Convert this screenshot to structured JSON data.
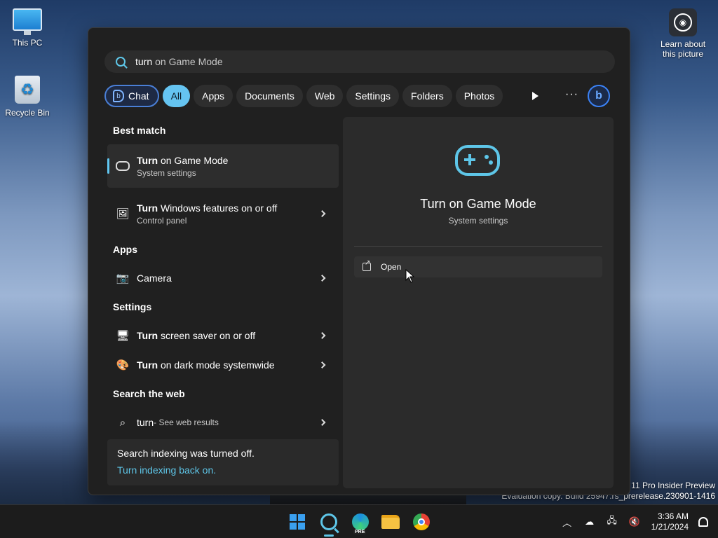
{
  "desktop": {
    "icons": [
      {
        "label": "This PC"
      },
      {
        "label": "Recycle Bin"
      }
    ],
    "learn_label_1": "Learn about",
    "learn_label_2": "this picture",
    "watermark_line1": "11 Pro Insider Preview",
    "watermark_line2": "Evaluation copy. Build 25947.rs_prerelease.230901-1416"
  },
  "search": {
    "typed": "turn",
    "completion": "on Game Mode"
  },
  "filters": {
    "chat": "Chat",
    "items": [
      "All",
      "Apps",
      "Documents",
      "Web",
      "Settings",
      "Folders",
      "Photos"
    ],
    "active": "All",
    "more": "···"
  },
  "results": {
    "best_match_header": "Best match",
    "best": {
      "bold": "Turn",
      "rest": " on Game Mode",
      "sub": "System settings"
    },
    "second": {
      "bold": "Turn",
      "rest": " Windows features on or off",
      "sub": "Control panel"
    },
    "apps_header": "Apps",
    "apps": [
      {
        "label": "Camera"
      }
    ],
    "settings_header": "Settings",
    "settings": [
      {
        "bold": "Turn",
        "rest": " screen saver on or off"
      },
      {
        "bold": "Turn",
        "rest": " on dark mode systemwide"
      }
    ],
    "web_header": "Search the web",
    "web": {
      "query": "turn",
      "suffix": " - See web results"
    },
    "index_notice": "Search indexing was turned off.",
    "index_link": "Turn indexing back on."
  },
  "preview": {
    "title": "Turn on Game Mode",
    "subtitle": "System settings",
    "open_label": "Open"
  },
  "taskbar": {
    "time": "3:36 AM",
    "date": "1/21/2024",
    "edge_badge": "PRE"
  },
  "colors": {
    "accent": "#5ec6e8",
    "panel_bg": "#202020",
    "chip_active": "#65c4f1"
  }
}
